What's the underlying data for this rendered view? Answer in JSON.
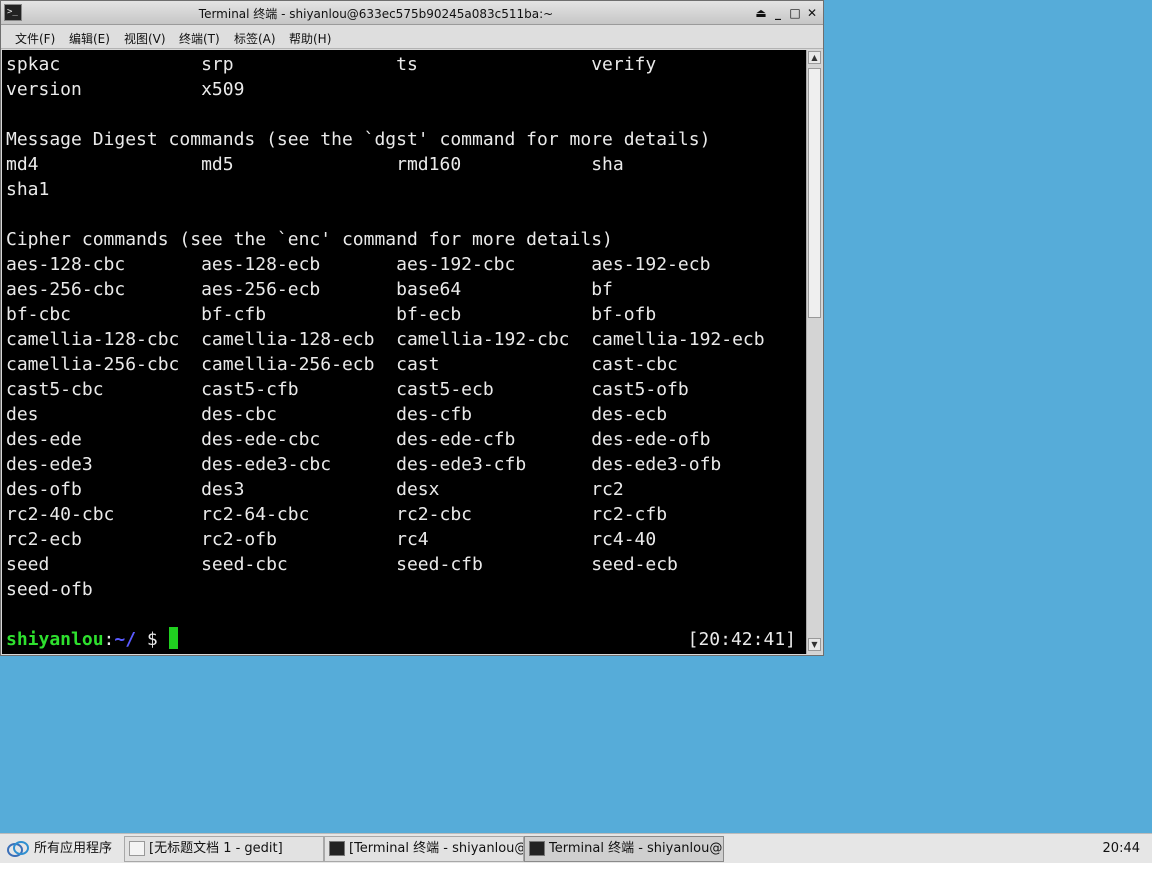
{
  "window": {
    "title": "Terminal 终端 - shiyanlou@633ec575b90245a083c511ba:~",
    "icon": "terminal-icon",
    "controls": [
      "⏏",
      "_",
      "□",
      "✕"
    ],
    "menus": [
      "文件(F)",
      "编辑(E)",
      "视图(V)",
      "终端(T)",
      "标签(A)",
      "帮助(H)"
    ]
  },
  "terminal": {
    "lines": [
      "spkac             srp               ts                verify",
      "version           x509",
      "",
      "Message Digest commands (see the `dgst' command for more details)",
      "md4               md5               rmd160            sha",
      "sha1",
      "",
      "Cipher commands (see the `enc' command for more details)",
      "aes-128-cbc       aes-128-ecb       aes-192-cbc       aes-192-ecb",
      "aes-256-cbc       aes-256-ecb       base64            bf",
      "bf-cbc            bf-cfb            bf-ecb            bf-ofb",
      "camellia-128-cbc  camellia-128-ecb  camellia-192-cbc  camellia-192-ecb",
      "camellia-256-cbc  camellia-256-ecb  cast              cast-cbc",
      "cast5-cbc         cast5-cfb         cast5-ecb         cast5-ofb",
      "des               des-cbc           des-cfb           des-ecb",
      "des-ede           des-ede-cbc       des-ede-cfb       des-ede-ofb",
      "des-ede3          des-ede3-cbc      des-ede3-cfb      des-ede3-ofb",
      "des-ofb           des3              desx              rc2",
      "rc2-40-cbc        rc2-64-cbc        rc2-cbc           rc2-cfb",
      "rc2-ecb           rc2-ofb           rc4               rc4-40",
      "seed              seed-cbc          seed-cfb          seed-ecb",
      "seed-ofb",
      ""
    ],
    "prompt": {
      "user": "shiyanlou",
      "sep": ":",
      "path": "~/",
      "symbol": " $ ",
      "time": "[20:42:41]"
    },
    "colors": {
      "background": "#000000",
      "text": "#eaeaea",
      "user": "#2ee02e",
      "path": "#5a5aff",
      "cursor": "#20d020"
    }
  },
  "taskbar": {
    "start_label": "所有应用程序",
    "items": [
      {
        "label": "[无标题文档 1 - gedit]",
        "icon": "gedit-icon",
        "active": false
      },
      {
        "label": "[Terminal 终端 - shiyanlou@…",
        "icon": "terminal-icon",
        "active": false
      },
      {
        "label": "Terminal 终端 - shiyanlou@…",
        "icon": "terminal-icon",
        "active": true
      }
    ],
    "clock": "20:44"
  },
  "desktop": {
    "background": "#56acd9"
  }
}
